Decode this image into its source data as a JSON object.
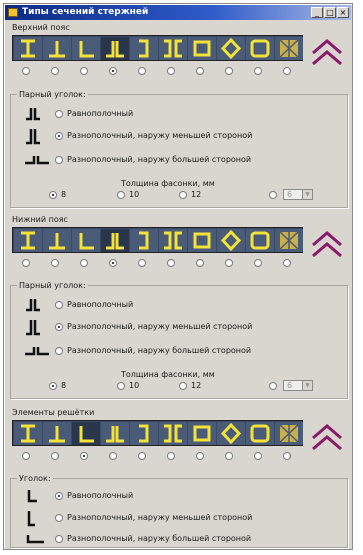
{
  "window": {
    "title": "Типы сечений стержней",
    "minimize": "_",
    "maximize": "□",
    "close": "×"
  },
  "colors": {
    "accent_yellow": "#f2e23a",
    "strip_bg": "#3a4a63",
    "chevron": "#8a1a6a"
  },
  "sections": [
    {
      "id": "top",
      "label": "Верхний пояс",
      "selected_index": 3,
      "corner_group_title": "Парный уголок:",
      "options": [
        "Равнополочный",
        "Разнополочный, наружу меньшей стороной",
        "Разнополочный, наружу большей стороной"
      ],
      "selected_option": 1,
      "thickness_title": "Толщина фасонки, мм",
      "thicknesses": [
        "8",
        "10",
        "12"
      ],
      "selected_thickness": 0,
      "custom_value": "6"
    },
    {
      "id": "bottom",
      "label": "Нижний пояс",
      "selected_index": 3,
      "corner_group_title": "Парный уголок:",
      "options": [
        "Равнополочный",
        "Разнополочный, наружу меньшей стороной",
        "Разнополочный, наружу большей стороной"
      ],
      "selected_option": 1,
      "thickness_title": "Толщина фасонки, мм",
      "thicknesses": [
        "8",
        "10",
        "12"
      ],
      "selected_thickness": 0,
      "custom_value": "6"
    },
    {
      "id": "web",
      "label": "Элементы решётки",
      "selected_index": 2,
      "corner_group_title": "Уголок:",
      "options": [
        "Равнополочный",
        "Разнополочный, наружу меньшей стороной",
        "Разнополочный, наружу большей стороной"
      ],
      "selected_option": 0
    }
  ],
  "profile_icons": [
    "i-beam-icon",
    "tee-icon",
    "angle-icon",
    "double-angle-icon",
    "channel-icon",
    "double-channel-icon",
    "box-icon",
    "pipe-icon",
    "square-tube-icon",
    "lattice-icon"
  ]
}
